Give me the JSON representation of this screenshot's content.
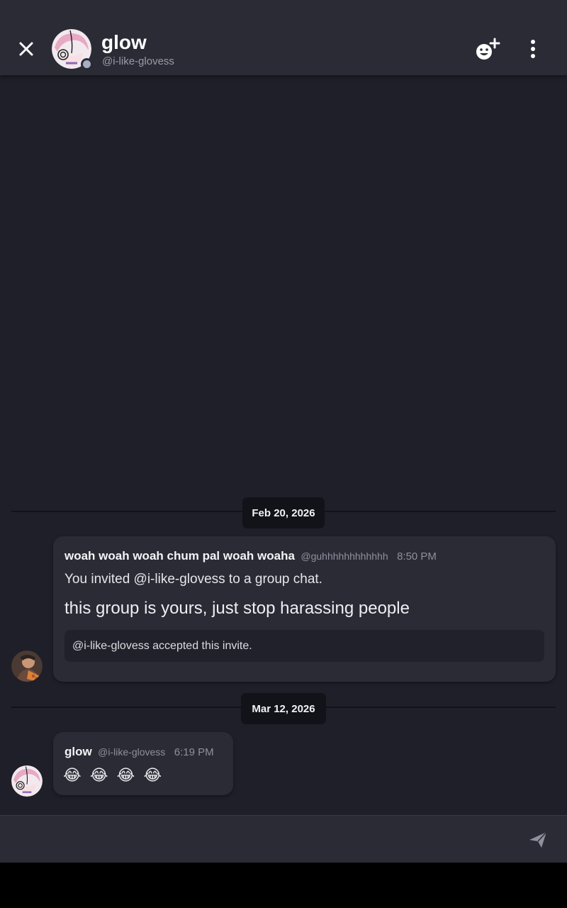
{
  "header": {
    "name": "glow",
    "handle": "@i-like-glovess"
  },
  "messages": [
    {
      "date": "Feb 20, 2026",
      "sender": "woah woah woah chum pal woah woaha",
      "handle": "@guhhhhhhhhhhhh",
      "time": "8:50 PM",
      "system_text": "You invited @i-like-glovess to a group chat.",
      "text": "this group is yours, just stop harassing people",
      "invite_status": "@i-like-glovess accepted this invite."
    },
    {
      "date": "Mar 12, 2026",
      "sender": "glow",
      "handle": "@i-like-glovess",
      "time": "6:19 PM",
      "text": "😂 😂 😂 😂"
    }
  ],
  "composer": {
    "placeholder": ""
  },
  "colors": {
    "background": "#1e1f28",
    "surface": "#2a2b35",
    "divider": "#121319",
    "status_dot": "#a9aec6"
  },
  "icons": [
    "close-icon",
    "add-friend-icon",
    "more-vertical-icon",
    "send-icon"
  ]
}
